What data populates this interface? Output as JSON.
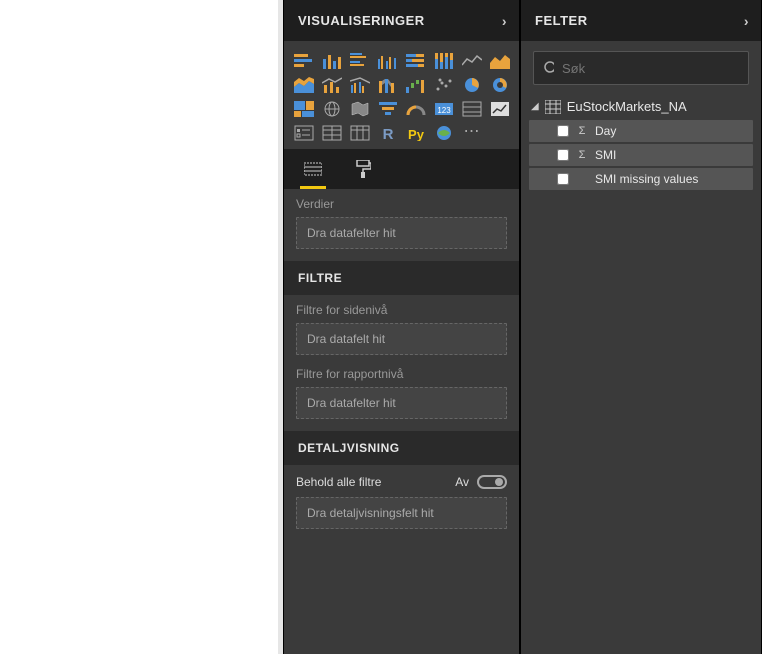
{
  "panels": {
    "visualizations": {
      "title": "VISUALISERINGER"
    },
    "fields": {
      "title": "FELTER"
    }
  },
  "viz": {
    "values_label": "Verdier",
    "values_placeholder": "Dra datafelter hit"
  },
  "filters": {
    "title": "FILTRE",
    "page_label": "Filtre for sidenivå",
    "page_placeholder": "Dra datafelt hit",
    "report_label": "Filtre for rapportnivå",
    "report_placeholder": "Dra datafelter hit"
  },
  "drill": {
    "title": "DETALJVISNING",
    "keep_all_label": "Behold alle filtre",
    "toggle_state": "Av",
    "placeholder": "Dra detaljvisningsfelt hit"
  },
  "search": {
    "placeholder": "Søk"
  },
  "table": {
    "name": "EuStockMarkets_NA",
    "fields": [
      {
        "name": "Day",
        "numeric": true
      },
      {
        "name": "SMI",
        "numeric": true
      },
      {
        "name": "SMI missing values",
        "numeric": false
      }
    ]
  },
  "viz_icons": [
    "stacked-bar",
    "stacked-column",
    "clustered-bar",
    "clustered-column",
    "100-stacked-bar",
    "100-stacked-column",
    "line",
    "area",
    "stacked-area",
    "line-stacked-column",
    "line-clustered-column",
    "ribbon",
    "waterfall",
    "scatter",
    "pie",
    "donut",
    "treemap",
    "map",
    "filled-map",
    "funnel",
    "gauge",
    "card",
    "multi-row-card",
    "kpi",
    "slicer",
    "table",
    "matrix",
    "r-script",
    "py-script",
    "arcgis",
    "more"
  ]
}
